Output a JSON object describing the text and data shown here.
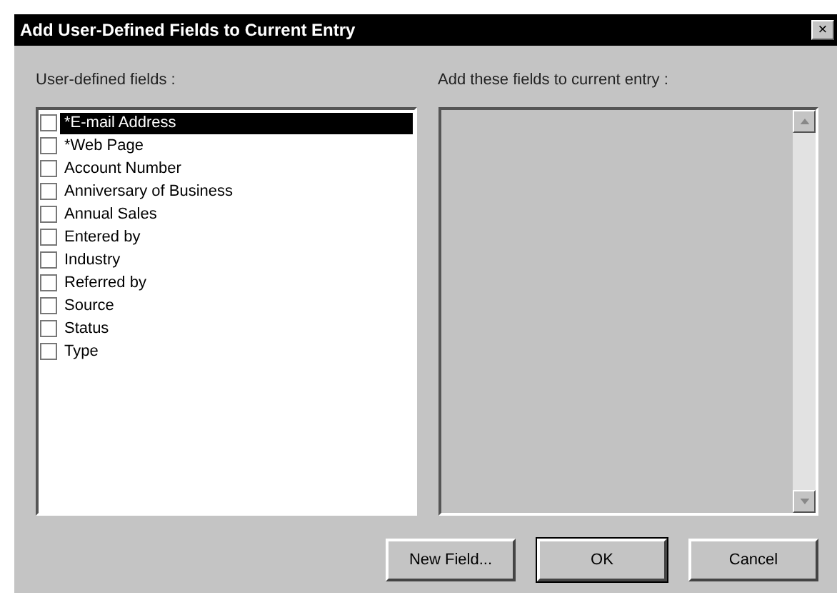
{
  "window": {
    "title": "Add User-Defined Fields to Current Entry",
    "close": "×"
  },
  "left_list": {
    "label": "User-defined fields :",
    "items": [
      {
        "label": "*E-mail Address",
        "checked": false,
        "selected": true
      },
      {
        "label": "*Web Page",
        "checked": false,
        "selected": false
      },
      {
        "label": "Account Number",
        "checked": false,
        "selected": false
      },
      {
        "label": "Anniversary of Business",
        "checked": false,
        "selected": false
      },
      {
        "label": "Annual Sales",
        "checked": false,
        "selected": false
      },
      {
        "label": "Entered by",
        "checked": false,
        "selected": false
      },
      {
        "label": "Industry",
        "checked": false,
        "selected": false
      },
      {
        "label": "Referred by",
        "checked": false,
        "selected": false
      },
      {
        "label": "Source",
        "checked": false,
        "selected": false
      },
      {
        "label": "Status",
        "checked": false,
        "selected": false
      },
      {
        "label": "Type",
        "checked": false,
        "selected": false
      }
    ]
  },
  "right_list": {
    "label": "Add these fields to current entry :"
  },
  "buttons": [
    "New Field...",
    "OK",
    "Cancel"
  ]
}
